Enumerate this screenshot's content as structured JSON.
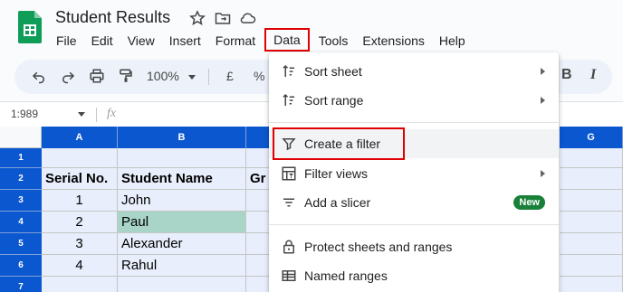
{
  "document": {
    "title": "Student Results"
  },
  "menu": [
    "File",
    "Edit",
    "View",
    "Insert",
    "Format",
    "Data",
    "Tools",
    "Extensions",
    "Help"
  ],
  "toolbar": {
    "zoom": "100%",
    "currency": "£",
    "percent": "%",
    "bold": "B",
    "italic": "I"
  },
  "formula_bar": {
    "cell_ref": "1:989",
    "fx": "fx"
  },
  "columns": [
    "A",
    "B",
    "G"
  ],
  "rows": [
    "1",
    "2",
    "3",
    "4",
    "5",
    "6",
    "7"
  ],
  "table": {
    "headers": [
      "Serial No.",
      "Student Name",
      "Gr"
    ],
    "rows": [
      [
        "1",
        "John"
      ],
      [
        "2",
        "Paul"
      ],
      [
        "3",
        "Alexander"
      ],
      [
        "4",
        "Rahul"
      ]
    ]
  },
  "data_menu": {
    "items": [
      {
        "label": "Sort sheet",
        "icon": "sort-icon",
        "submenu": true
      },
      {
        "label": "Sort range",
        "icon": "sort-icon",
        "submenu": true
      },
      {
        "label": "Create a filter",
        "icon": "filter-icon",
        "submenu": false
      },
      {
        "label": "Filter views",
        "icon": "filter-views-icon",
        "submenu": true
      },
      {
        "label": "Add a slicer",
        "icon": "slicer-icon",
        "submenu": false,
        "badge": "New"
      },
      {
        "label": "Protect sheets and ranges",
        "icon": "lock-icon",
        "submenu": false
      },
      {
        "label": "Named ranges",
        "icon": "named-ranges-icon",
        "submenu": false
      }
    ]
  },
  "colors": {
    "header_blue": "#0b57d0",
    "cell_fill": "#e8eefb",
    "highlight_teal": "#a8d5c8",
    "annotation_red": "#e00000",
    "badge_green": "#188038"
  }
}
